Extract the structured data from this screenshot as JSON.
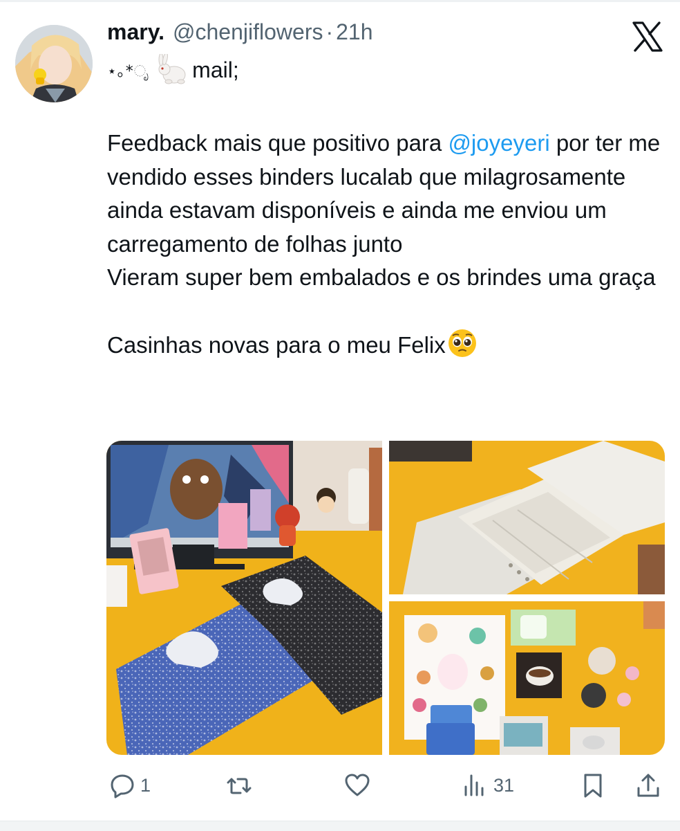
{
  "tweet": {
    "author_name": "mary.",
    "author_handle": "@chenjiflowers",
    "separator": "·",
    "time": "21h",
    "sub_line_text": "mail;",
    "sub_line_sparkles": "⋆｡*ೃ",
    "text_segments": {
      "line1_before": "Feedback mais que positivo para ",
      "mention": "@joyeyeri",
      "line1_after": " por ter me vendido esses binders lucalab que milagrosamente ainda estavam disponíveis e ainda me enviou um carregamento de folhas junto",
      "line2": "Vieram super bem embalados e os brindes uma graça",
      "line3": "Casinhas novas para o meu Felix"
    },
    "images": [
      {
        "label": "composition-book-binders-on-desk"
      },
      {
        "label": "binder-sheets-in-plastic"
      },
      {
        "label": "sticker-freebies"
      }
    ]
  },
  "actions": {
    "replies": "1",
    "reposts": "",
    "likes": "",
    "views": "31"
  },
  "colors": {
    "accent": "#1d9bf0",
    "text": "#0f1419",
    "muted": "#536471",
    "desk_yellow": "#f1b21e"
  }
}
